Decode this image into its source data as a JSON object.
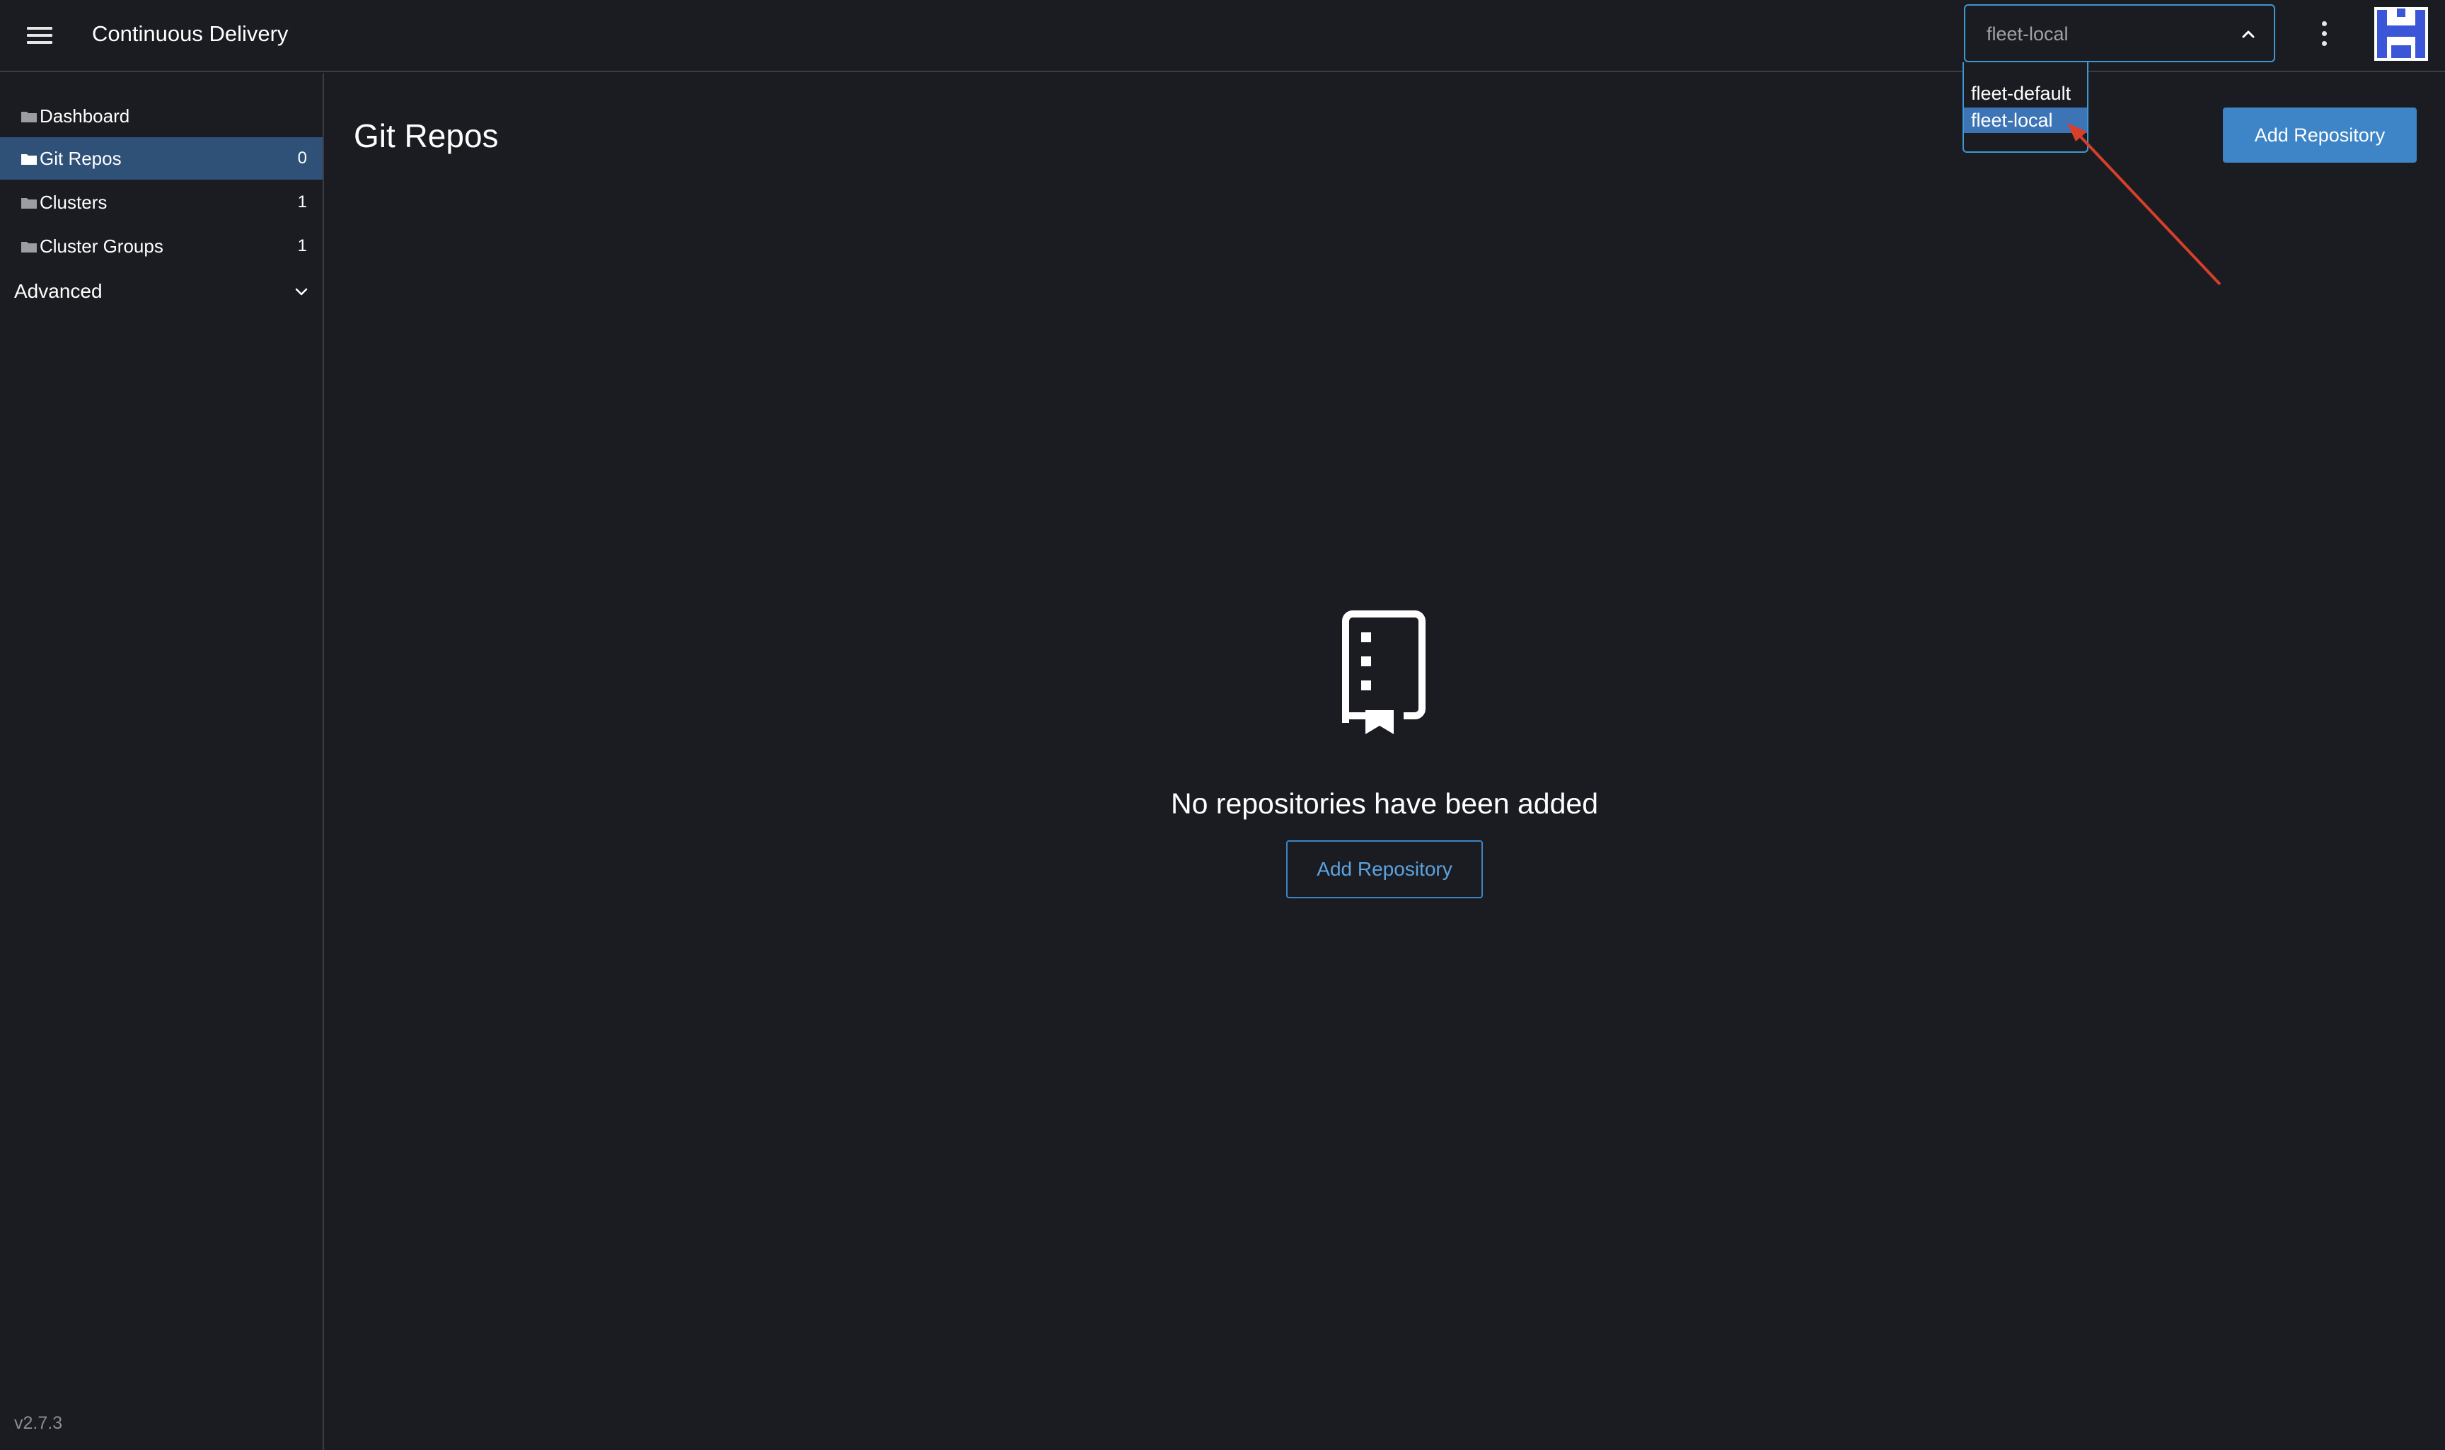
{
  "header": {
    "title": "Continuous Delivery",
    "workspace_select": {
      "value": "fleet-local",
      "options": [
        "fleet-default",
        "fleet-local"
      ],
      "highlighted": "fleet-local"
    }
  },
  "sidebar": {
    "items": [
      {
        "label": "Dashboard",
        "count": ""
      },
      {
        "label": "Git Repos",
        "count": "0"
      },
      {
        "label": "Clusters",
        "count": "1"
      },
      {
        "label": "Cluster Groups",
        "count": "1"
      }
    ],
    "group_label": "Advanced",
    "version": "v2.7.3"
  },
  "main": {
    "title": "Git Repos",
    "add_button_label": "Add Repository",
    "empty_state": {
      "message": "No repositories have been added",
      "button_label": "Add Repository"
    }
  },
  "colors": {
    "background": "#1b1c21",
    "accent": "#3d85c6",
    "active_nav": "#2f5178",
    "annotation_arrow": "#d6402a",
    "avatar_blue": "#3b56d6"
  },
  "icons": {
    "menu": "hamburger-menu-icon",
    "chevron": "chevron-up-icon",
    "more": "kebab-menu-icon",
    "folder": "folder-icon",
    "empty_state": "repository-bookmark-icon"
  }
}
